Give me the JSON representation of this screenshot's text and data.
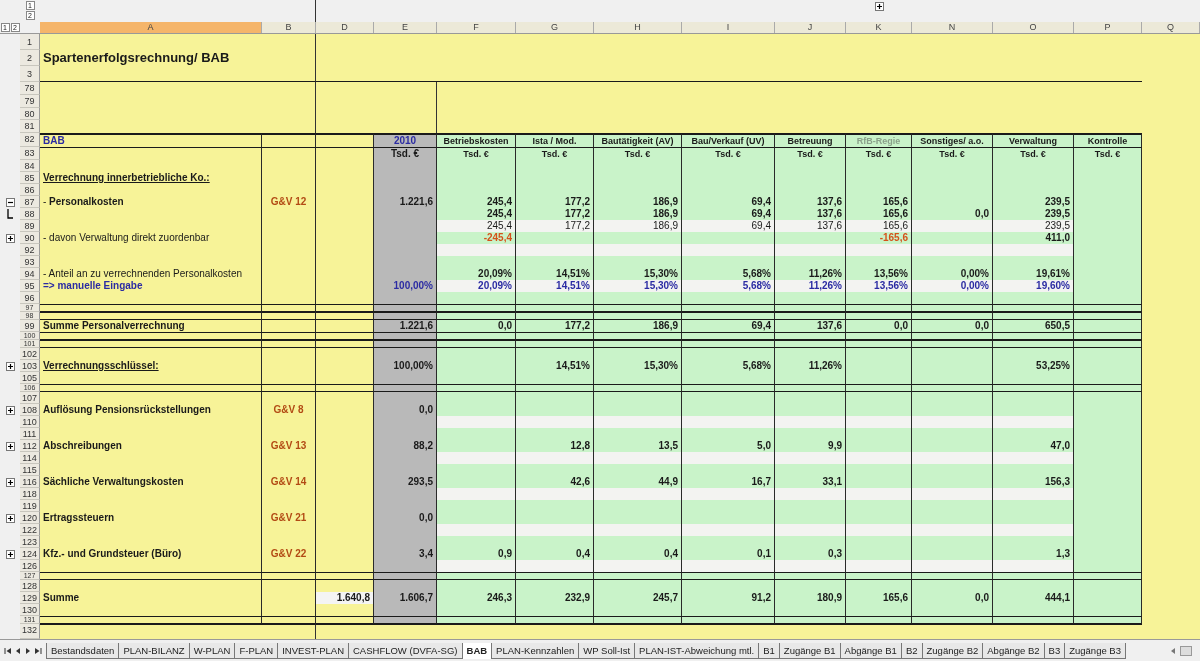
{
  "outline_levels": {
    "rows": [
      "1",
      "2"
    ],
    "columns": [
      "1",
      "2"
    ]
  },
  "columns": [
    {
      "label": "A",
      "selected": true
    },
    {
      "label": "B",
      "selected": false
    },
    {
      "label": "D",
      "selected": false
    },
    {
      "label": "E",
      "selected": false
    },
    {
      "label": "F",
      "selected": false
    },
    {
      "label": "G",
      "selected": false
    },
    {
      "label": "H",
      "selected": false
    },
    {
      "label": "I",
      "selected": false
    },
    {
      "label": "J",
      "selected": false
    },
    {
      "label": "K",
      "selected": false
    },
    {
      "label": "N",
      "selected": false
    },
    {
      "label": "O",
      "selected": false
    },
    {
      "label": "P",
      "selected": false
    },
    {
      "label": "Q",
      "selected": false
    }
  ],
  "rows": [
    {
      "number": "1",
      "kind": "top"
    },
    {
      "number": "2",
      "kind": "top",
      "title": "Spartenerfolgsrechnung/ BAB"
    },
    {
      "number": "3",
      "kind": "top_last"
    },
    {
      "number": "78",
      "kind": "blank"
    },
    {
      "number": "79",
      "kind": "blank"
    },
    {
      "number": "80",
      "kind": "blank"
    },
    {
      "number": "81",
      "kind": "blank"
    },
    {
      "number": "82",
      "kind": "header",
      "label": {
        "text": "BAB",
        "bold": true,
        "color": "#2b2ba3"
      },
      "e": {
        "text": "2010",
        "bold": true,
        "color": "#2b2ba3"
      },
      "values_bold": true,
      "values": {
        "F": "Betriebskosten",
        "G": "Ista / Mod.",
        "H": "Bautätigkeit (AV)",
        "I": "Bau/Verkauf (UV)",
        "J": "Betreuung",
        "K": {
          "text": "RfB-Regie",
          "color": "#8aa08a"
        },
        "N": "Sonstiges/ a.o.",
        "O": "Verwaltung",
        "P": "Kontrolle"
      }
    },
    {
      "number": "83",
      "kind": "header",
      "e": {
        "text": "Tsd. €",
        "bold": true
      },
      "values_bold": true,
      "values": {
        "F": "Tsd. €",
        "G": "Tsd. €",
        "H": "Tsd. €",
        "I": "Tsd. €",
        "J": "Tsd. €",
        "K": "Tsd. €",
        "N": "Tsd. €",
        "O": "Tsd. €",
        "P": "Tsd. €"
      }
    },
    {
      "number": "84",
      "kind": "data"
    },
    {
      "number": "85",
      "kind": "data",
      "label": {
        "text": "Verrechnung innerbetriebliche Ko.:",
        "bold": true,
        "underlined": true
      }
    },
    {
      "number": "86",
      "kind": "data"
    },
    {
      "number": "87",
      "kind": "data",
      "group_toggle": {
        "expanded": true
      },
      "label": {
        "text": "- **Personalkosten**"
      },
      "ref": "G&V 12",
      "e": {
        "text": "1.221,6",
        "bold": true
      },
      "values_bold": true,
      "values": {
        "F": "245,4",
        "G": "177,2",
        "H": "186,9",
        "I": "69,4",
        "J": "137,6",
        "K": "165,6",
        "O": "239,5"
      }
    },
    {
      "number": "88",
      "kind": "data",
      "group_end": true,
      "values_bold": true,
      "values": {
        "F": "245,4",
        "G": "177,2",
        "H": "186,9",
        "I": "69,4",
        "J": "137,6",
        "K": "165,6",
        "N": "0,0",
        "O": "239,5"
      }
    },
    {
      "number": "89",
      "kind": "data",
      "light": true,
      "values": {
        "F": "245,4",
        "G": "177,2",
        "H": "186,9",
        "I": "69,4",
        "J": "137,6",
        "K": "165,6",
        "O": "239,5"
      }
    },
    {
      "number": "90",
      "kind": "data",
      "group_toggle": {
        "expanded": false
      },
      "label": {
        "text": "- davon Verwaltung direkt zuordenbar"
      },
      "values": {
        "F": {
          "text": "-245,4",
          "bold": true,
          "color": "#d4521a"
        },
        "K": {
          "text": "-165,6",
          "bold": true,
          "color": "#d4521a"
        },
        "O": {
          "text": "411,0",
          "bold": true
        }
      }
    },
    {
      "number": "92",
      "kind": "data",
      "light": true
    },
    {
      "number": "93",
      "kind": "data"
    },
    {
      "number": "94",
      "kind": "data",
      "label": {
        "text": "- Anteil an zu verrechnenden Personalkosten"
      },
      "values_bold": true,
      "values": {
        "F": "20,09%",
        "G": "14,51%",
        "H": "15,30%",
        "I": "5,68%",
        "J": "11,26%",
        "K": "13,56%",
        "N": "0,00%",
        "O": "19,61%"
      }
    },
    {
      "number": "95",
      "kind": "data",
      "light": true,
      "label": {
        "text": "=> manuelle Eingabe",
        "bold": true,
        "color": "#2b2ba3"
      },
      "e": {
        "text": "100,00%",
        "bold": true,
        "color": "#2b2ba3"
      },
      "values_bold": true,
      "values": {
        "F": {
          "text": "20,09%",
          "color": "#2b2ba3"
        },
        "G": {
          "text": "14,51%",
          "color": "#2b2ba3"
        },
        "H": {
          "text": "15,30%",
          "color": "#2b2ba3"
        },
        "I": {
          "text": "5,68%",
          "color": "#2b2ba3"
        },
        "J": {
          "text": "11,26%",
          "color": "#2b2ba3"
        },
        "K": {
          "text": "13,56%",
          "color": "#2b2ba3"
        },
        "N": {
          "text": "0,00%",
          "color": "#2b2ba3"
        },
        "O": {
          "text": "19,60%",
          "color": "#2b2ba3"
        }
      }
    },
    {
      "number": "96",
      "kind": "data"
    },
    {
      "number": "97",
      "kind": "rule"
    },
    {
      "number": "98",
      "kind": "rule"
    },
    {
      "number": "99",
      "kind": "data",
      "label": {
        "text": "Summe Personalverrechnung",
        "bold": true
      },
      "e": {
        "text": "1.221,6",
        "bold": true
      },
      "values_bold": true,
      "values": {
        "F": "0,0",
        "G": "177,2",
        "H": "186,9",
        "I": "69,4",
        "J": "137,6",
        "K": "0,0",
        "N": "0,0",
        "O": "650,5"
      }
    },
    {
      "number": "100",
      "kind": "rule"
    },
    {
      "number": "101",
      "kind": "rule"
    },
    {
      "number": "102",
      "kind": "data"
    },
    {
      "number": "103",
      "kind": "data",
      "group_toggle": {
        "expanded": false
      },
      "label": {
        "text": "Verrechnungsschlüssel:",
        "bold": true,
        "underlined": true
      },
      "e": {
        "text": "100,00%",
        "bold": true
      },
      "values_bold": true,
      "values": {
        "G": "14,51%",
        "H": "15,30%",
        "I": "5,68%",
        "J": "11,26%",
        "O": "53,25%"
      }
    },
    {
      "number": "105",
      "kind": "data"
    },
    {
      "number": "106",
      "kind": "rule"
    },
    {
      "number": "107",
      "kind": "data"
    },
    {
      "number": "108",
      "kind": "data",
      "group_toggle": {
        "expanded": false
      },
      "label": {
        "text": "Auflösung Pensionsrückstellungen",
        "bold": true
      },
      "ref": "G&V 8",
      "e": {
        "text": "0,0",
        "bold": true
      }
    },
    {
      "number": "110",
      "kind": "data",
      "light": true
    },
    {
      "number": "111",
      "kind": "data"
    },
    {
      "number": "112",
      "kind": "data",
      "group_toggle": {
        "expanded": false
      },
      "label": {
        "text": "Abschreibungen",
        "bold": true
      },
      "ref": "G&V 13",
      "e": {
        "text": "88,2",
        "bold": true
      },
      "values_bold": true,
      "values": {
        "G": "12,8",
        "H": "13,5",
        "I": "5,0",
        "J": "9,9",
        "O": "47,0"
      }
    },
    {
      "number": "114",
      "kind": "data",
      "light": true
    },
    {
      "number": "115",
      "kind": "data"
    },
    {
      "number": "116",
      "kind": "data",
      "group_toggle": {
        "expanded": false
      },
      "label": {
        "text": "Sächliche Verwaltungskosten",
        "bold": true
      },
      "ref": "G&V 14",
      "e": {
        "text": "293,5",
        "bold": true
      },
      "values_bold": true,
      "values": {
        "G": "42,6",
        "H": "44,9",
        "I": "16,7",
        "J": "33,1",
        "O": "156,3"
      }
    },
    {
      "number": "118",
      "kind": "data",
      "light": true
    },
    {
      "number": "119",
      "kind": "data"
    },
    {
      "number": "120",
      "kind": "data",
      "group_toggle": {
        "expanded": false
      },
      "label": {
        "text": "Ertragssteuern",
        "bold": true
      },
      "ref": "G&V 21",
      "e": {
        "text": "0,0",
        "bold": true
      }
    },
    {
      "number": "122",
      "kind": "data",
      "light": true
    },
    {
      "number": "123",
      "kind": "data"
    },
    {
      "number": "124",
      "kind": "data",
      "group_toggle": {
        "expanded": false
      },
      "label": {
        "text": "Kfz.- und Grundsteuer (Büro)",
        "bold": true
      },
      "ref": "G&V 22",
      "e": {
        "text": "3,4",
        "bold": true
      },
      "values_bold": true,
      "values": {
        "F": "0,9",
        "G": "0,4",
        "H": "0,4",
        "I": "0,1",
        "J": "0,3",
        "O": "1,3"
      }
    },
    {
      "number": "126",
      "kind": "data",
      "light": true
    },
    {
      "number": "127",
      "kind": "rule"
    },
    {
      "number": "128",
      "kind": "data"
    },
    {
      "number": "129",
      "kind": "data",
      "label": {
        "text": "Summe",
        "bold": true
      },
      "d": "1.640,8",
      "e": {
        "text": "1.606,7",
        "bold": true
      },
      "values_bold": true,
      "values": {
        "F": "246,3",
        "G": "232,9",
        "H": "245,7",
        "I": "91,2",
        "J": "180,9",
        "K": "165,6",
        "N": "0,0",
        "O": "444,1"
      }
    },
    {
      "number": "130",
      "kind": "data"
    },
    {
      "number": "131",
      "kind": "rule"
    },
    {
      "number": "132",
      "kind": "bottom"
    }
  ],
  "sheet_tabs": [
    {
      "label": "Bestandsdaten",
      "selected": false
    },
    {
      "label": "PLAN-BILANZ",
      "selected": false
    },
    {
      "label": "W-PLAN",
      "selected": false
    },
    {
      "label": "F-PLAN",
      "selected": false
    },
    {
      "label": "INVEST-PLAN",
      "selected": false
    },
    {
      "label": "CASHFLOW (DVFA-SG)",
      "selected": false
    },
    {
      "label": "BAB",
      "selected": true
    },
    {
      "label": "PLAN-Kennzahlen",
      "selected": false
    },
    {
      "label": "WP Soll-Ist",
      "selected": false
    },
    {
      "label": "PLAN-IST-Abweichung mtl.",
      "selected": false
    },
    {
      "label": "B1",
      "selected": false
    },
    {
      "label": "Zugänge B1",
      "selected": false
    },
    {
      "label": "Abgänge B1",
      "selected": false
    },
    {
      "label": "B2",
      "selected": false
    },
    {
      "label": "Zugänge B2",
      "selected": false
    },
    {
      "label": "Abgänge B2",
      "selected": false
    },
    {
      "label": "B3",
      "selected": false
    },
    {
      "label": "Zugänge B3",
      "selected": false
    }
  ]
}
